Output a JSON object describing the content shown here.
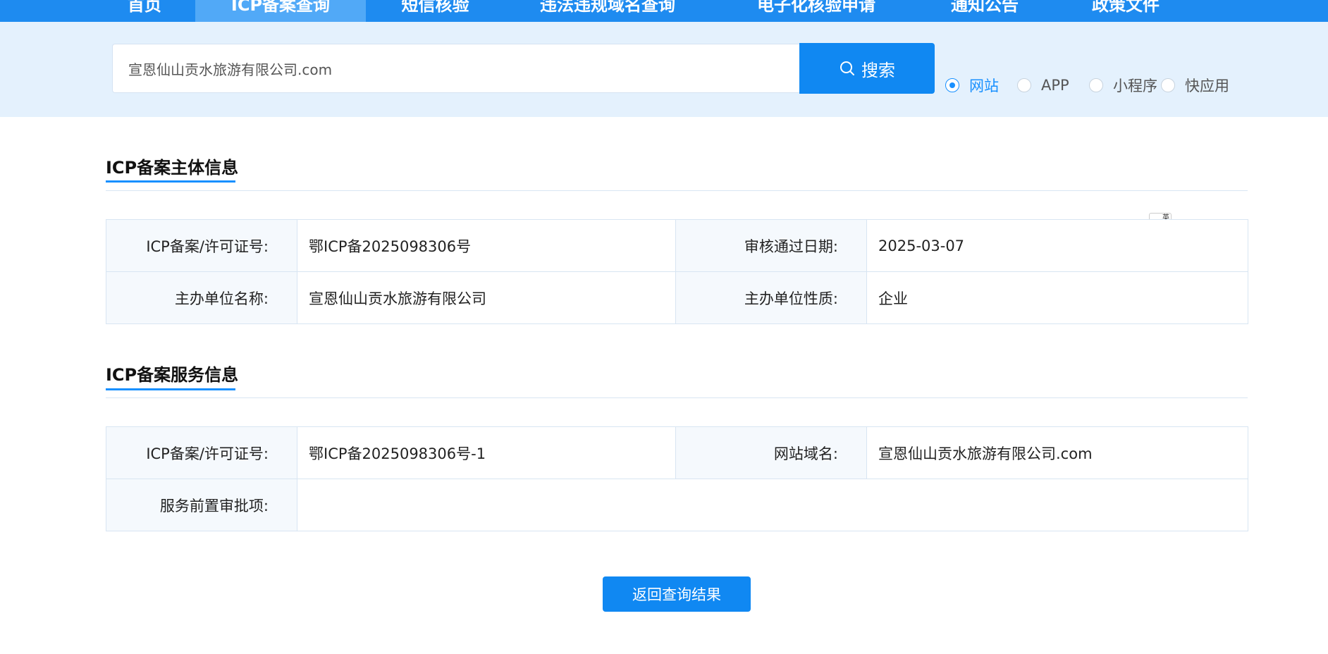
{
  "nav": {
    "items": [
      "首页",
      "ICP备案查询",
      "短信核验",
      "违法违规域名查询",
      "电子化核验申请",
      "通知公告",
      "政策文件"
    ],
    "active_index": 1
  },
  "search": {
    "value": "宣恩仙山贡水旅游有限公司.com",
    "button_label": "搜索",
    "types": [
      {
        "label": "网站",
        "checked": true
      },
      {
        "label": "APP",
        "checked": false
      },
      {
        "label": "小程序",
        "checked": false
      },
      {
        "label": "快应用",
        "checked": false
      }
    ]
  },
  "subject_info": {
    "title": "ICP备案主体信息",
    "license_label": "ICP备案/许可证号:",
    "license_value": "鄂ICP备2025098306号",
    "approval_date_label": "审核通过日期:",
    "approval_date_value": "2025-03-07",
    "org_name_label": "主办单位名称:",
    "org_name_value": "宣恩仙山贡水旅游有限公司",
    "org_type_label": "主办单位性质:",
    "org_type_value": "企业"
  },
  "service_info": {
    "title": "ICP备案服务信息",
    "license_label": "ICP备案/许可证号:",
    "license_value": "鄂ICP备2025098306号-1",
    "domain_label": "网站域名:",
    "domain_value": "宣恩仙山贡水旅游有限公司.com",
    "pre_approval_label": "服务前置审批项:",
    "pre_approval_value": ""
  },
  "back_button_label": "返回查询结果",
  "translate_icon": {
    "top": "英",
    "bottom": "en"
  },
  "colors": {
    "primary": "#1088f2",
    "nav_bg": "#1e8bf0",
    "search_band": "#e4f1fd",
    "accent": "#1890ff"
  }
}
